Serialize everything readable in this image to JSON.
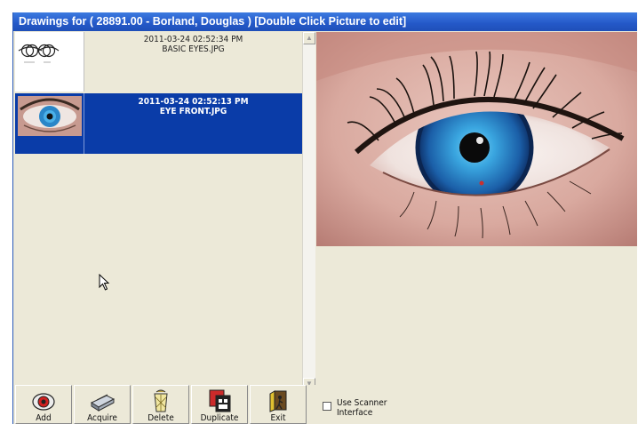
{
  "window": {
    "title": "Drawings for ( 28891.00 - Borland, Douglas  ) [Double Click Picture to edit]"
  },
  "drawings": [
    {
      "timestamp": "2011-03-24 02:52:34 PM",
      "filename": "BASIC EYES.JPG",
      "selected": false
    },
    {
      "timestamp": "2011-03-24 02:52:13 PM",
      "filename": "EYE FRONT.JPG",
      "selected": true
    }
  ],
  "toolbar": {
    "add_label": "Add",
    "acquire_label": "Acquire",
    "delete_label": "Delete",
    "duplicate_label": "Duplicate",
    "exit_label": "Exit"
  },
  "scanner_option": {
    "label": "Use Scanner Interface",
    "checked": false
  },
  "colors": {
    "title_bar": "#2458c8",
    "selection": "#0a3ca8",
    "panel": "#ece9d8"
  },
  "icons": {
    "add": "add-icon",
    "acquire": "scanner-icon",
    "delete": "recycle-bin-icon",
    "duplicate": "duplicate-icon",
    "exit": "exit-door-icon"
  }
}
